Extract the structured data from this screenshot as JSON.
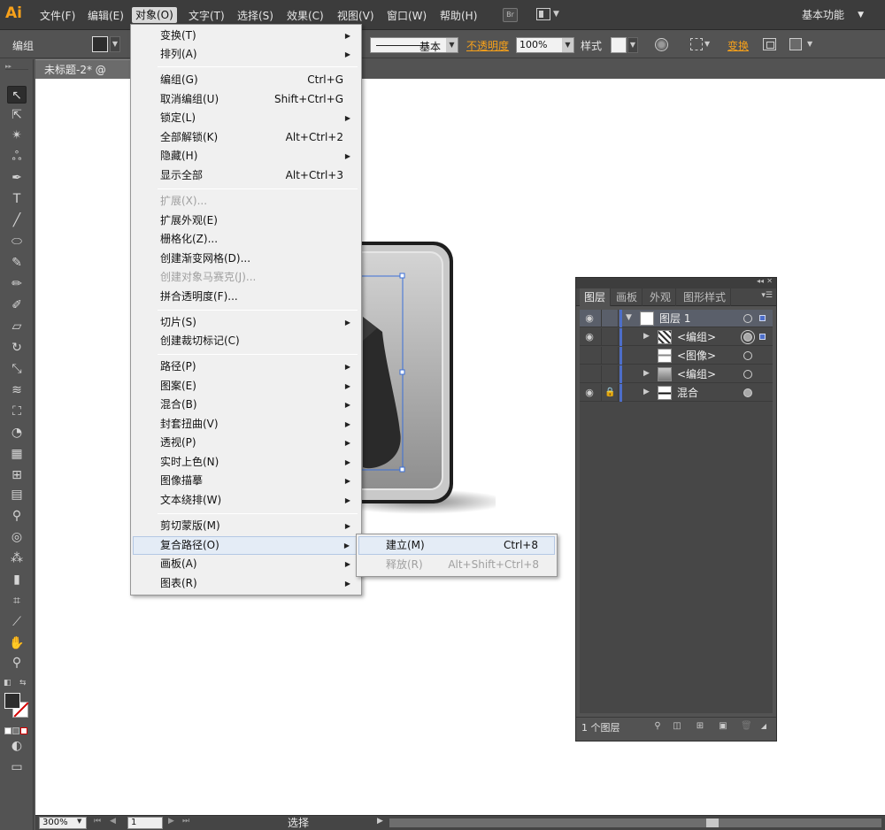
{
  "app": {
    "logo": "Ai",
    "menus": [
      "文件(F)",
      "编辑(E)",
      "对象(O)",
      "文字(T)",
      "选择(S)",
      "效果(C)",
      "视图(V)",
      "窗口(W)",
      "帮助(H)"
    ],
    "bridge_label": "Br",
    "workspace": "基本功能"
  },
  "control_bar": {
    "selection_label": "编组",
    "stroke_style": "基本",
    "opacity_label": "不透明度",
    "opacity_value": "100%",
    "style_label": "样式",
    "transform_label": "变换",
    "fill_color": "#2d2d2d"
  },
  "document": {
    "tab_title": "未标题-2* @ 300%"
  },
  "object_menu": {
    "items": [
      {
        "label": "变换(T)",
        "shortcut": "",
        "submenu": true,
        "disabled": false
      },
      {
        "label": "排列(A)",
        "shortcut": "",
        "submenu": true,
        "disabled": false
      },
      {
        "label": "编组(G)",
        "shortcut": "Ctrl+G",
        "submenu": false,
        "disabled": false
      },
      {
        "label": "取消编组(U)",
        "shortcut": "Shift+Ctrl+G",
        "submenu": false,
        "disabled": false
      },
      {
        "label": "锁定(L)",
        "shortcut": "",
        "submenu": true,
        "disabled": false
      },
      {
        "label": "全部解锁(K)",
        "shortcut": "Alt+Ctrl+2",
        "submenu": false,
        "disabled": false
      },
      {
        "label": "隐藏(H)",
        "shortcut": "",
        "submenu": true,
        "disabled": false
      },
      {
        "label": "显示全部",
        "shortcut": "Alt+Ctrl+3",
        "submenu": false,
        "disabled": false
      },
      {
        "label": "扩展(X)...",
        "shortcut": "",
        "submenu": false,
        "disabled": true
      },
      {
        "label": "扩展外观(E)",
        "shortcut": "",
        "submenu": false,
        "disabled": false
      },
      {
        "label": "栅格化(Z)...",
        "shortcut": "",
        "submenu": false,
        "disabled": false
      },
      {
        "label": "创建渐变网格(D)...",
        "shortcut": "",
        "submenu": false,
        "disabled": false
      },
      {
        "label": "创建对象马赛克(J)...",
        "shortcut": "",
        "submenu": false,
        "disabled": true
      },
      {
        "label": "拼合透明度(F)...",
        "shortcut": "",
        "submenu": false,
        "disabled": false
      },
      {
        "label": "切片(S)",
        "shortcut": "",
        "submenu": true,
        "disabled": false
      },
      {
        "label": "创建裁切标记(C)",
        "shortcut": "",
        "submenu": false,
        "disabled": false
      },
      {
        "label": "路径(P)",
        "shortcut": "",
        "submenu": true,
        "disabled": false
      },
      {
        "label": "图案(E)",
        "shortcut": "",
        "submenu": true,
        "disabled": false
      },
      {
        "label": "混合(B)",
        "shortcut": "",
        "submenu": true,
        "disabled": false
      },
      {
        "label": "封套扭曲(V)",
        "shortcut": "",
        "submenu": true,
        "disabled": false
      },
      {
        "label": "透视(P)",
        "shortcut": "",
        "submenu": true,
        "disabled": false
      },
      {
        "label": "实时上色(N)",
        "shortcut": "",
        "submenu": true,
        "disabled": false
      },
      {
        "label": "图像描摹",
        "shortcut": "",
        "submenu": true,
        "disabled": false
      },
      {
        "label": "文本绕排(W)",
        "shortcut": "",
        "submenu": true,
        "disabled": false
      },
      {
        "label": "剪切蒙版(M)",
        "shortcut": "",
        "submenu": true,
        "disabled": false
      },
      {
        "label": "复合路径(O)",
        "shortcut": "",
        "submenu": true,
        "disabled": false
      },
      {
        "label": "画板(A)",
        "shortcut": "",
        "submenu": true,
        "disabled": false
      },
      {
        "label": "图表(R)",
        "shortcut": "",
        "submenu": true,
        "disabled": false
      }
    ]
  },
  "compound_path_submenu": {
    "items": [
      {
        "label": "建立(M)",
        "shortcut": "Ctrl+8",
        "disabled": false
      },
      {
        "label": "释放(R)",
        "shortcut": "Alt+Shift+Ctrl+8",
        "disabled": true
      }
    ]
  },
  "layers_panel": {
    "tabs": [
      "图层",
      "画板",
      "外观",
      "图形样式"
    ],
    "rows": [
      {
        "name": "图层 1",
        "visible": true,
        "locked": false
      },
      {
        "name": "<编组>",
        "visible": true,
        "locked": false
      },
      {
        "name": "<图像>",
        "visible": false,
        "locked": false
      },
      {
        "name": "<编组>",
        "visible": false,
        "locked": false
      },
      {
        "name": "混合",
        "visible": true,
        "locked": true
      }
    ],
    "layer_count": "1 个图层",
    "accent_color": "#4d6ec9"
  },
  "status_bar": {
    "zoom": "300%",
    "artboard": "1",
    "tool": "选择"
  }
}
